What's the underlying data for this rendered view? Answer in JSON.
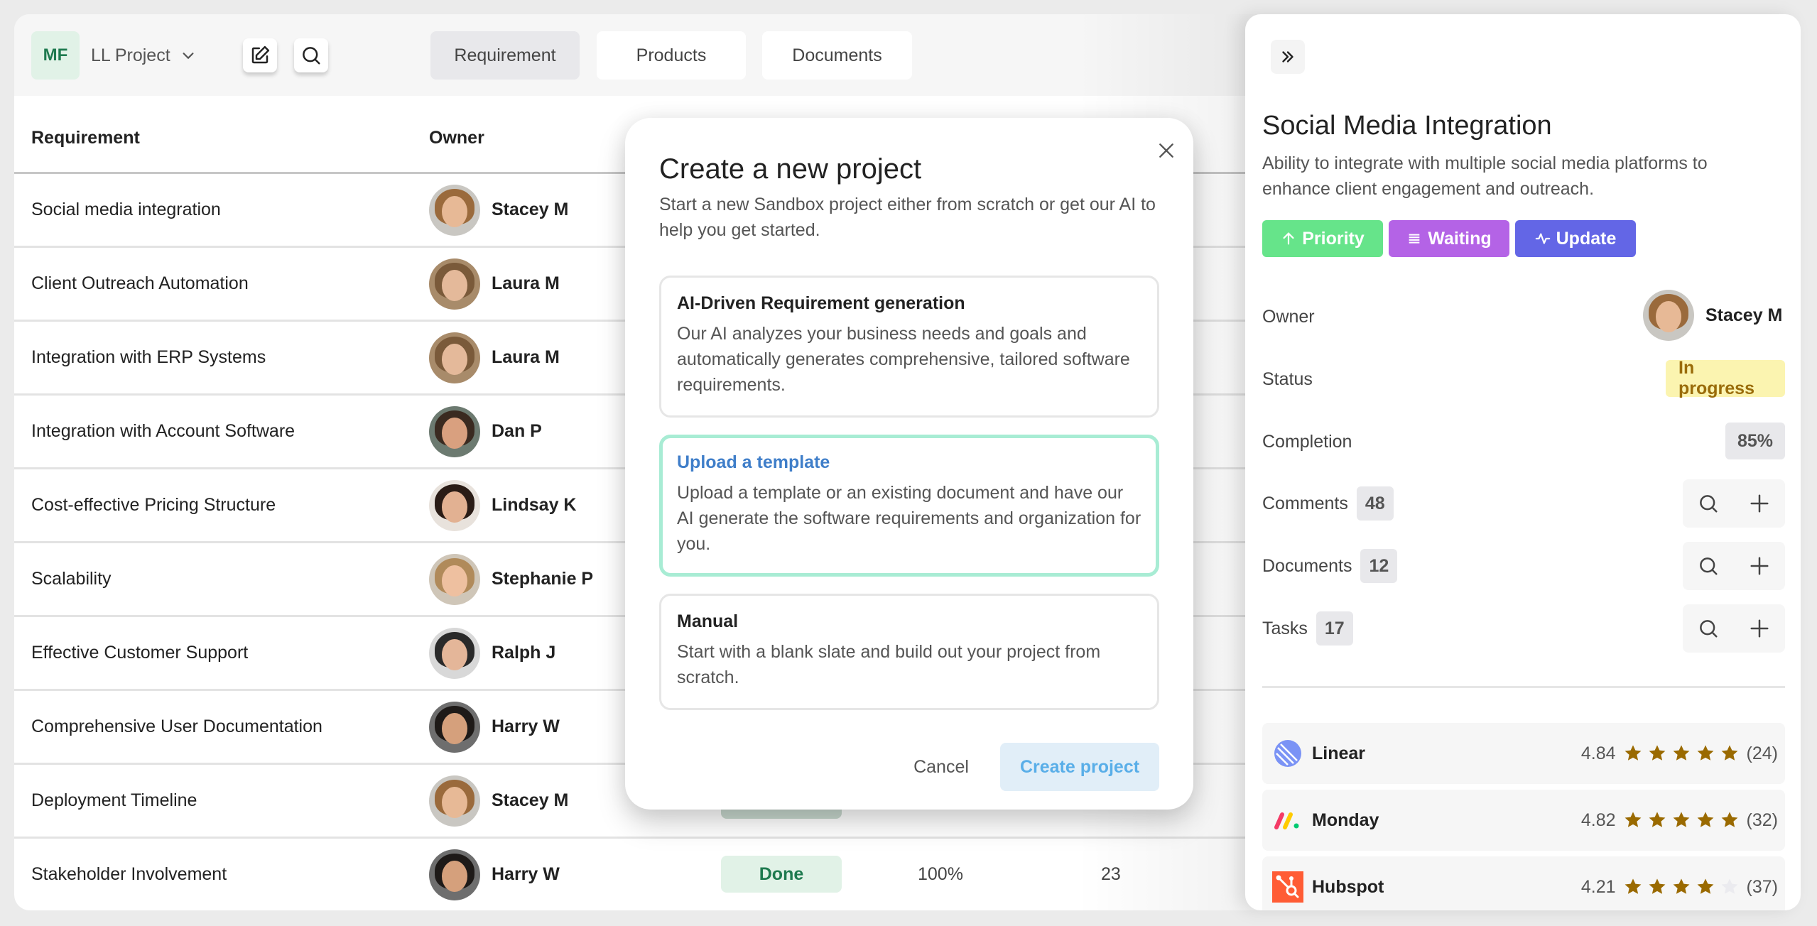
{
  "toolbar": {
    "workspace_initials": "MF",
    "project_name": "LL Project",
    "tabs": [
      {
        "label": "Requirement",
        "active": true
      },
      {
        "label": "Products",
        "active": false
      },
      {
        "label": "Documents",
        "active": false
      }
    ]
  },
  "table": {
    "columns": [
      "Requirement",
      "Owner"
    ],
    "rows": [
      {
        "requirement": "Social media integration",
        "owner": "Stacey M"
      },
      {
        "requirement": "Client Outreach Automation",
        "owner": "Laura M"
      },
      {
        "requirement": "Integration with ERP Systems",
        "owner": "Laura M"
      },
      {
        "requirement": "Integration with Account Software",
        "owner": "Dan P"
      },
      {
        "requirement": "Cost-effective Pricing Structure",
        "owner": "Lindsay K"
      },
      {
        "requirement": "Scalability",
        "owner": "Stephanie P"
      },
      {
        "requirement": "Effective Customer Support",
        "owner": "Ralph J"
      },
      {
        "requirement": "Comprehensive User Documentation",
        "owner": "Harry W"
      },
      {
        "requirement": "Deployment Timeline",
        "owner": "Stacey M"
      },
      {
        "requirement": "Stakeholder Involvement",
        "owner": "Harry W",
        "status": "Done",
        "completion": "100%",
        "count": "23"
      }
    ]
  },
  "modal": {
    "title": "Create a new project",
    "subtitle": "Start a new Sandbox project either from scratch or get our AI to help you get started.",
    "options": [
      {
        "title": "AI-Driven Requirement generation",
        "description": "Our AI analyzes your business needs and goals and automatically generates comprehensive, tailored software requirements.",
        "selected": false
      },
      {
        "title": "Upload a template",
        "description": "Upload a template or an existing document and have our AI generate the software requirements and organization for you.",
        "selected": true
      },
      {
        "title": "Manual",
        "description": "Start with a blank slate and build out your project from scratch.",
        "selected": false
      }
    ],
    "cancel_label": "Cancel",
    "create_label": "Create project"
  },
  "panel": {
    "title": "Social Media Integration",
    "description": "Ability to integrate with multiple social media platforms to enhance client engagement and outreach.",
    "tags": [
      {
        "label": "Priority",
        "icon": "arrow-up-icon",
        "color": "#66e48a"
      },
      {
        "label": "Waiting",
        "icon": "list-icon",
        "color": "#b463e6"
      },
      {
        "label": "Update",
        "icon": "activity-icon",
        "color": "#6366e6"
      }
    ],
    "owner_label": "Owner",
    "owner_name": "Stacey M",
    "status_label": "Status",
    "status_value": "In progress",
    "completion_label": "Completion",
    "completion_value": "85%",
    "comments_label": "Comments",
    "comments_count": "48",
    "documents_label": "Documents",
    "documents_count": "12",
    "tasks_label": "Tasks",
    "tasks_count": "17",
    "apps": [
      {
        "name": "Linear",
        "score": "4.84",
        "stars": 5,
        "reviews": "(24)"
      },
      {
        "name": "Monday",
        "score": "4.82",
        "stars": 5,
        "reviews": "(32)"
      },
      {
        "name": "Hubspot",
        "score": "4.21",
        "stars": 4,
        "reviews": "(37)"
      }
    ]
  },
  "colors": {
    "accent_green": "#1e7a4f",
    "selected_border": "#a8ecd4",
    "star": "#9a6a00",
    "star_empty": "#ebebef"
  }
}
